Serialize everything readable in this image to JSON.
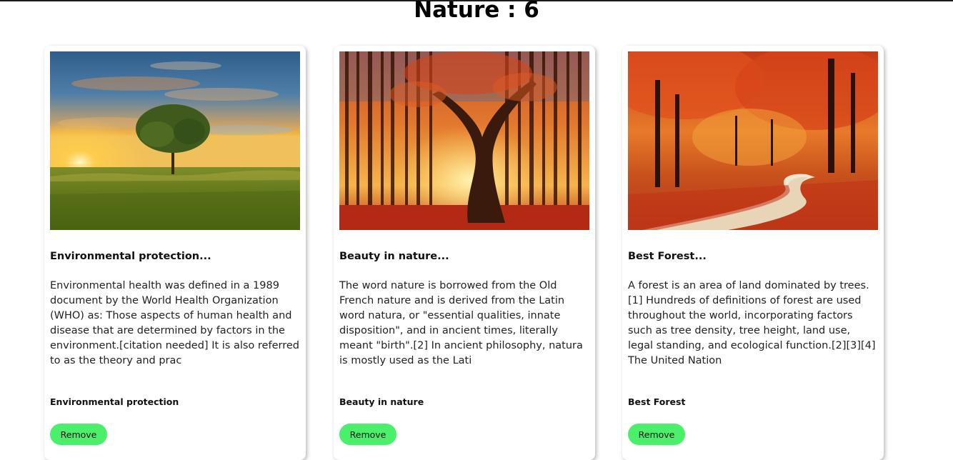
{
  "page": {
    "title": "Nature : 6"
  },
  "cards": [
    {
      "image_name": "tree-sunset-field-image",
      "title": "Environmental protection...",
      "description": "Environmental health was defined in a 1989 document by the World Health Organization (WHO) as: Those aspects of human health and disease that are determined by factors in the environment.[citation needed] It is also referred to as the theory and prac",
      "subtitle": "Environmental protection",
      "button_label": "Remove"
    },
    {
      "image_name": "autumn-tree-forest-image",
      "title": "Beauty in nature...",
      "description": "The word nature is borrowed from the Old French nature and is derived from the Latin word natura, or \"essential qualities, innate disposition\", and in ancient times, literally meant \"birth\".[2] In ancient philosophy, natura is mostly used as the Lati",
      "subtitle": "Beauty in nature",
      "button_label": "Remove"
    },
    {
      "image_name": "autumn-forest-path-image",
      "title": "Best Forest...",
      "description": "A forest is an area of land dominated by trees.[1] Hundreds of definitions of forest are used throughout the world, incorporating factors such as tree density, tree height, land use, legal standing, and ecological function.[2][3][4] The United Nation",
      "subtitle": "Best Forest",
      "button_label": "Remove"
    }
  ],
  "colors": {
    "button_bg": "#4aef6a",
    "top_rule": "#1a1a1a"
  }
}
